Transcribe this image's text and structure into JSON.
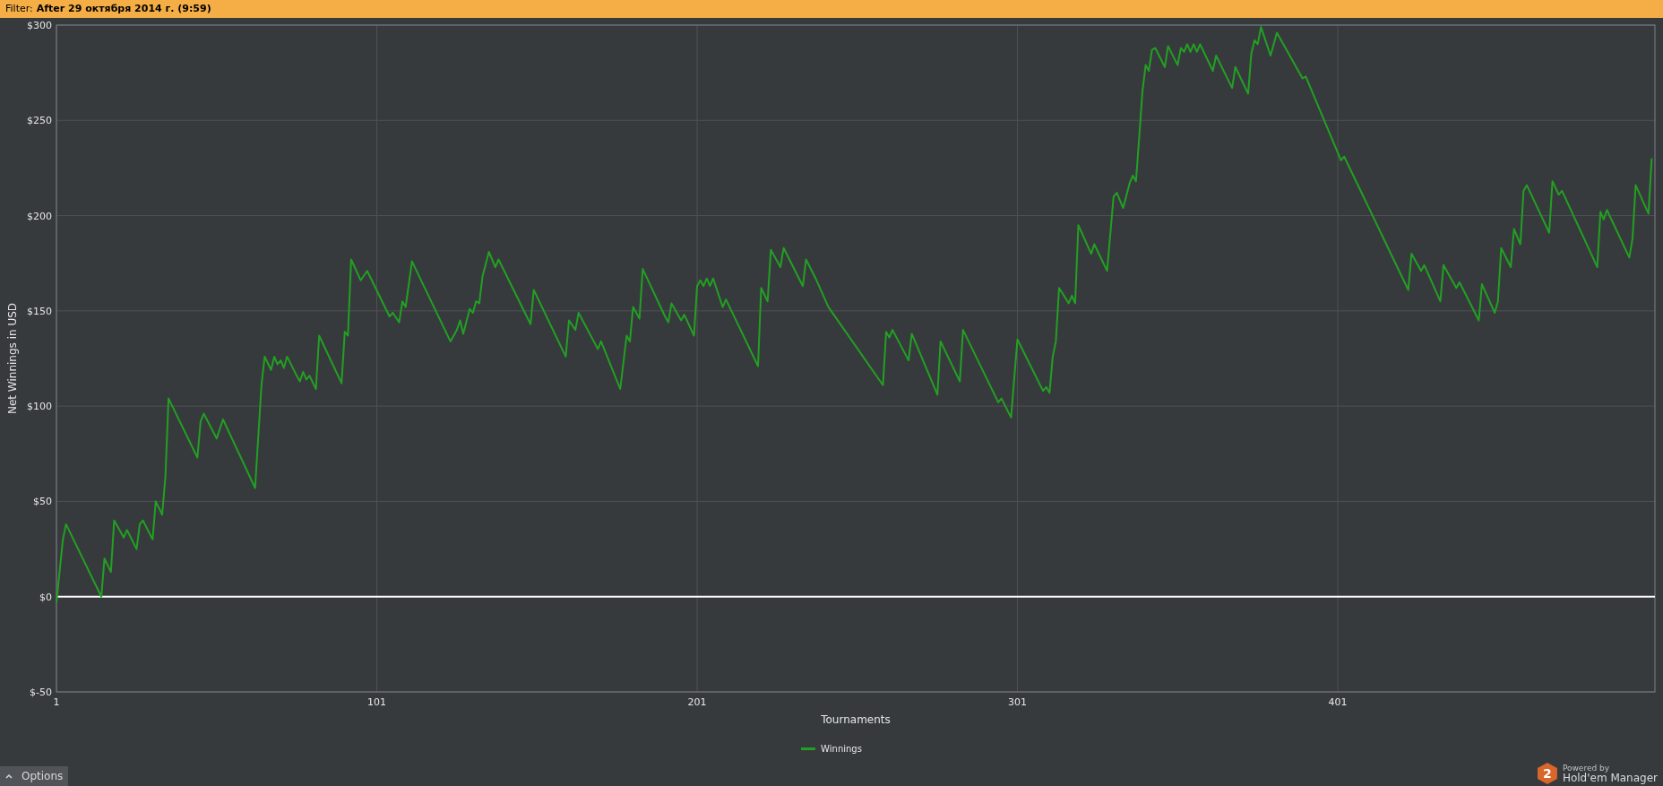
{
  "filter_bar": {
    "label": "Filter:",
    "value": "After 29 октября 2014 г. (9:59)"
  },
  "chart": {
    "chart_data": {
      "type": "line",
      "grid": true,
      "xlabel": "Tournaments",
      "ylabel": "Net Winnings in USD",
      "xlim": [
        1,
        500
      ],
      "ylim": [
        -50,
        300
      ],
      "xticks": [
        1,
        101,
        201,
        301,
        401
      ],
      "yticks": [
        {
          "value": -50,
          "label": "$-50"
        },
        {
          "value": 0,
          "label": "$0"
        },
        {
          "value": 50,
          "label": "$50"
        },
        {
          "value": 100,
          "label": "$100"
        },
        {
          "value": 150,
          "label": "$150"
        },
        {
          "value": 200,
          "label": "$200"
        },
        {
          "value": 250,
          "label": "$250"
        },
        {
          "value": 300,
          "label": "$300"
        }
      ],
      "x": [
        1,
        3,
        4,
        15,
        16,
        18,
        19,
        22,
        23,
        26,
        27,
        28,
        31,
        32,
        34,
        35,
        36,
        45,
        46,
        47,
        51,
        53,
        63,
        65,
        66,
        68,
        69,
        70,
        71,
        72,
        73,
        76,
        77,
        78,
        79,
        80,
        82,
        83,
        90,
        91,
        92,
        93,
        96,
        98,
        105,
        106,
        108,
        109,
        110,
        112,
        124,
        126,
        127,
        128,
        130,
        131,
        132,
        133,
        134,
        136,
        138,
        139,
        149,
        150,
        160,
        161,
        163,
        164,
        170,
        171,
        177,
        179,
        180,
        181,
        183,
        184,
        191,
        192,
        193,
        196,
        197,
        200,
        201,
        202,
        203,
        204,
        205,
        206,
        209,
        210,
        220,
        221,
        223,
        224,
        227,
        228,
        234,
        235,
        238,
        242,
        259,
        260,
        261,
        262,
        267,
        268,
        276,
        277,
        283,
        284,
        295,
        296,
        299,
        301,
        309,
        310,
        311,
        312,
        313,
        314,
        317,
        318,
        319,
        320,
        324,
        325,
        329,
        331,
        332,
        334,
        336,
        337,
        338,
        339,
        340,
        341,
        342,
        343,
        344,
        347,
        348,
        351,
        352,
        353,
        354,
        355,
        356,
        357,
        358,
        362,
        363,
        368,
        369,
        373,
        374,
        375,
        376,
        377,
        380,
        382,
        390,
        391,
        402,
        403,
        423,
        424,
        427,
        428,
        433,
        434,
        438,
        439,
        445,
        446,
        450,
        451,
        452,
        455,
        456,
        458,
        459,
        460,
        467,
        468,
        470,
        471,
        482,
        483,
        484,
        485,
        492,
        493,
        494,
        498,
        499
      ],
      "series": [
        {
          "name": "Winnings",
          "color": "#22a022",
          "values": [
            -3,
            30,
            38,
            0,
            20,
            13,
            40,
            31,
            35,
            25,
            38,
            40,
            30,
            50,
            43,
            63,
            104,
            73,
            92,
            96,
            83,
            93,
            57,
            111,
            126,
            119,
            126,
            122,
            124,
            120,
            126,
            116,
            113,
            118,
            114,
            116,
            109,
            137,
            112,
            139,
            137,
            177,
            166,
            171,
            147,
            149,
            144,
            155,
            152,
            176,
            134,
            140,
            145,
            138,
            151,
            149,
            155,
            154,
            168,
            181,
            173,
            177,
            143,
            161,
            126,
            145,
            140,
            149,
            130,
            134,
            109,
            137,
            134,
            152,
            146,
            172,
            147,
            144,
            154,
            145,
            148,
            137,
            163,
            166,
            163,
            167,
            163,
            167,
            152,
            156,
            121,
            162,
            155,
            182,
            173,
            183,
            163,
            177,
            167,
            152,
            111,
            139,
            136,
            140,
            124,
            138,
            106,
            134,
            113,
            140,
            102,
            104,
            94,
            135,
            108,
            110,
            107,
            126,
            134,
            162,
            154,
            158,
            154,
            195,
            180,
            185,
            171,
            210,
            212,
            204,
            217,
            221,
            218,
            241,
            265,
            279,
            276,
            287,
            288,
            278,
            289,
            279,
            288,
            286,
            290,
            286,
            290,
            286,
            290,
            276,
            284,
            267,
            278,
            264,
            285,
            292,
            290,
            299,
            284,
            296,
            272,
            273,
            229,
            231,
            161,
            180,
            171,
            174,
            155,
            174,
            162,
            165,
            145,
            164,
            149,
            155,
            183,
            173,
            193,
            185,
            213,
            216,
            191,
            218,
            211,
            213,
            173,
            202,
            198,
            203,
            178,
            188,
            216,
            201,
            230
          ]
        }
      ]
    }
  },
  "options_button": {
    "label": "Options"
  },
  "branding": {
    "mark": "2",
    "powered": "Powered by",
    "product": "Hold'em Manager"
  }
}
